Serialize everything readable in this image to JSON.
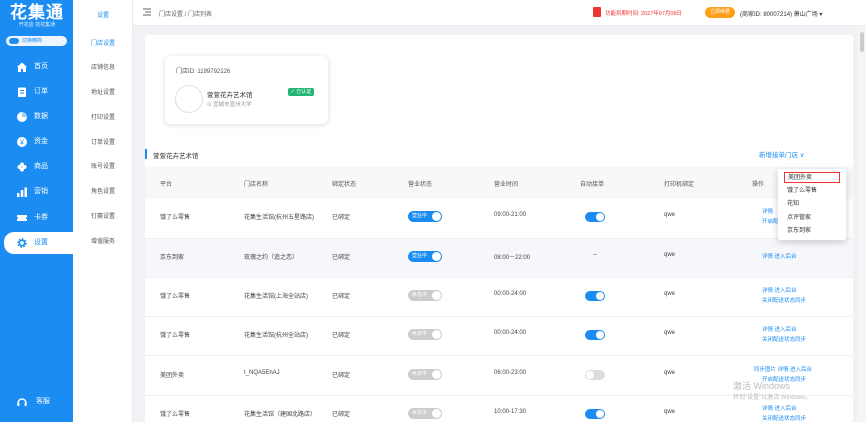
{
  "logo": {
    "title": "花集通",
    "subtitle": "开花店 找花集通"
  },
  "mode_switch": "切换精简",
  "nav": [
    {
      "label": "首页",
      "icon": "home-icon"
    },
    {
      "label": "订单",
      "icon": "clipboard-icon"
    },
    {
      "label": "数据",
      "icon": "pie-chart-icon"
    },
    {
      "label": "资金",
      "icon": "coin-icon"
    },
    {
      "label": "商品",
      "icon": "flower-icon"
    },
    {
      "label": "营销",
      "icon": "chart-icon"
    },
    {
      "label": "卡券",
      "icon": "ticket-icon"
    },
    {
      "label": "设置",
      "icon": "gear-icon"
    }
  ],
  "service": "客服",
  "subnav": {
    "head": "设置",
    "items": [
      "门店设置",
      "店铺信息",
      "地址设置",
      "打印设置",
      "订单设置",
      "账号设置",
      "角色设置",
      "钉赛设置",
      "增值服务"
    ]
  },
  "topbar": {
    "breadcrumb": "门店设置 / 门店列表",
    "expire": "功能到期时间: 2027年07月08日",
    "renew": "立即续费",
    "merchant": "(商家ID: 80007214)  萧山广场 ▾"
  },
  "store": {
    "id": "门店ID: 1199792126",
    "name": "萱萱花卉艺术馆",
    "location": "宣城市宣州大学",
    "verified": "已认证"
  },
  "section_title": "萱萱花卉艺术馆",
  "add_store": "新增接单门店 ∨",
  "table": {
    "headers": [
      "平台",
      "门店名称",
      "绑定状态",
      "营业状态",
      "营业时间",
      "自动接单",
      "打印机绑定",
      "操作"
    ],
    "rows": [
      {
        "platform": "饿了么零售",
        "name": "花集生活馆(杭州五星路店)",
        "bind": "已绑定",
        "status": "营业中",
        "status_on": true,
        "hours": "09:00-21:00",
        "auto": true,
        "printer": "qwe",
        "ops": [
          "详情",
          "开启配"
        ]
      },
      {
        "platform": "京东到家",
        "name": "玫瑰之约（追之恋）",
        "bind": "已绑定",
        "status": "营业中",
        "status_on": true,
        "hours": "08:00－22:00",
        "auto": null,
        "auto_text": "--",
        "printer": "qwe",
        "ops": [
          "详情  进入后台"
        ]
      },
      {
        "platform": "饿了么零售",
        "name": "花集生活馆(上海全站店)",
        "bind": "已绑定",
        "status": "休息中",
        "status_on": false,
        "hours": "00:00-24:00",
        "auto": true,
        "printer": "qwe",
        "ops": [
          "详情  进入后台",
          "关闭配送状态同步"
        ]
      },
      {
        "platform": "饿了么零售",
        "name": "花集生活馆(杭州全站店)",
        "bind": "已绑定",
        "status": "休息中",
        "status_on": false,
        "hours": "00:00-24:00",
        "auto": true,
        "printer": "qwe",
        "ops": [
          "详情  进入后台",
          "关闭配送状态同步"
        ]
      },
      {
        "platform": "美团外卖",
        "name": "t_NQA5EhAJ",
        "bind": "已绑定",
        "status": "休息中",
        "status_on": false,
        "hours": "06:00-23:00",
        "auto": false,
        "printer": "qwe",
        "ops": [
          "同步图片  详情  进入后台",
          "开启配送状态同步"
        ]
      },
      {
        "platform": "饿了么零售",
        "name": "花集生活馆（建国北路店）",
        "bind": "已绑定",
        "status": "休息中",
        "status_on": false,
        "hours": "10:00-17:30",
        "auto": true,
        "printer": "qwe",
        "ops": [
          "详情  进入后台",
          "关闭配送状态同步"
        ]
      }
    ]
  },
  "dropdown": [
    "美团外卖",
    "饿了么零售",
    "花知",
    "点评管家",
    "京东到家"
  ],
  "watermark": {
    "line1": "激活 Windows",
    "line2": "转到\"设置\"以激活 Windows。"
  },
  "colors": {
    "primary": "#1b8cf2",
    "danger": "#e33",
    "success": "#22b573",
    "warning": "#ff9f1a"
  }
}
